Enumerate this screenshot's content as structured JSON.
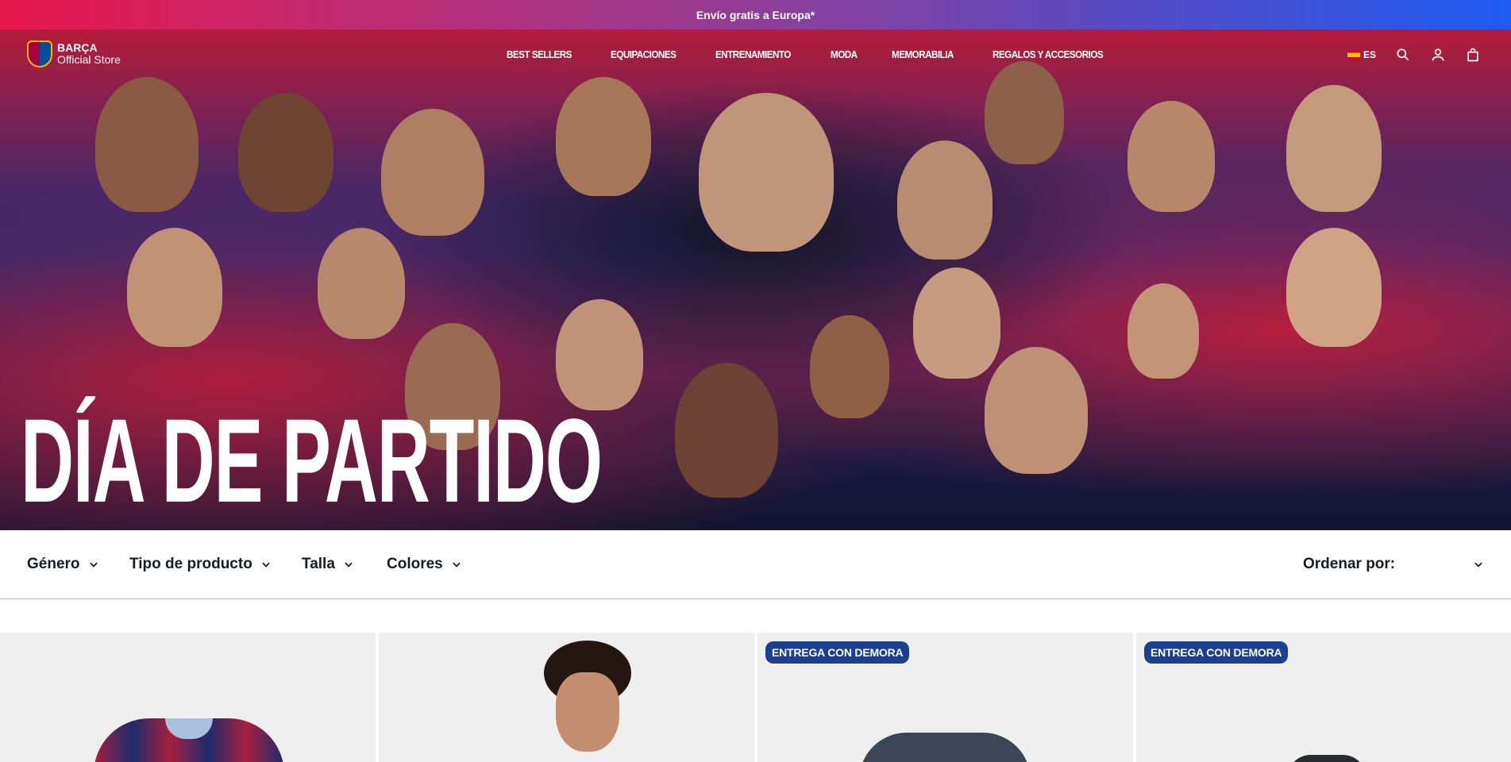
{
  "promo": {
    "text": "Envío gratis a Europa*"
  },
  "header": {
    "logo_line1": "BARÇA",
    "logo_line2": "Official Store",
    "nav": [
      "BEST SELLERS",
      "EQUIPACIONES",
      "ENTRENAMIENTO",
      "MODA",
      "MEMORABILIA",
      "REGALOS Y ACCESORIOS"
    ],
    "language": "ES",
    "icons": [
      "flag-es-icon",
      "search-icon",
      "user-icon",
      "shopping-bag-icon"
    ]
  },
  "hero": {
    "title": "DÍA DE PARTIDO"
  },
  "filters": {
    "items": [
      "Género",
      "Tipo de producto",
      "Talla",
      "Colores"
    ],
    "sort_label": "Ordenar por:"
  },
  "products": [
    {
      "badge": ""
    },
    {
      "badge": ""
    },
    {
      "badge": "ENTREGA CON DEMORA"
    },
    {
      "badge": "ENTREGA CON DEMORA"
    }
  ],
  "colors": {
    "promo_start": "#e7194f",
    "promo_end": "#1d5bf2",
    "badge_bg": "#1c3f8f",
    "text_dark": "#181b25",
    "card_bg": "#efeff0"
  }
}
